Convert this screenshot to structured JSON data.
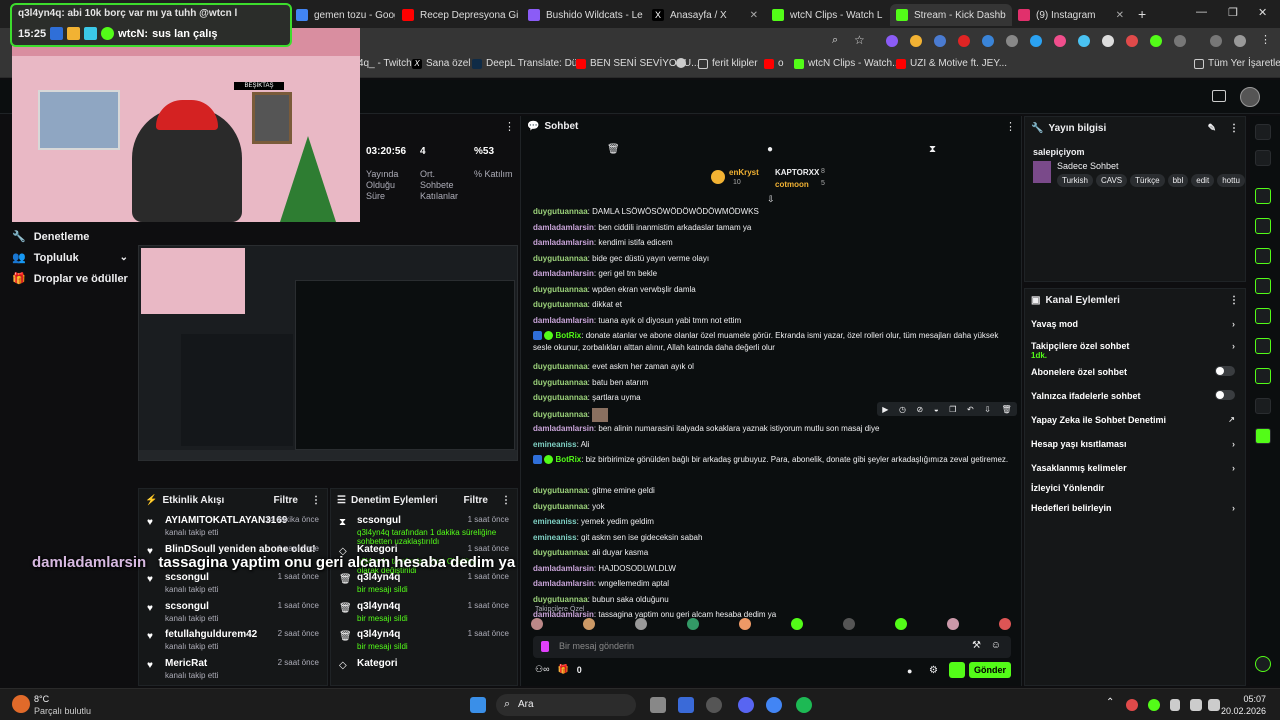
{
  "browser": {
    "tabs": [
      {
        "label": "gemen tozu - Google",
        "color": "#4285f4"
      },
      {
        "label": "Recep Depresyona Gi",
        "color": "#ff0000"
      },
      {
        "label": "Bushido Wildcats - Le",
        "color": "#8b5cf6"
      },
      {
        "label": "Anasayfa / X",
        "color": "#ffffff"
      },
      {
        "label": "wtcN Clips - Watch L",
        "color": "#53fc18"
      },
      {
        "label": "Stream - Kick Dashb",
        "color": "#53fc18"
      },
      {
        "label": "(9) Instagram",
        "color": "#e1306c"
      }
    ],
    "bookmarks": [
      "4q_ - Twitch",
      "Sana özel",
      "DeepL Translate: Dü...",
      "BEN SENİ SEVİYORU...",
      "o",
      "ferit klipler",
      "o",
      "wtcN Clips - Watch...",
      "UZI & Motive ft. JEY...",
      "Tüm Yer İşaretleri"
    ]
  },
  "overlay": {
    "chat_line1": "q3l4yn4q: abi 10k borç var mı ya tuhh @wtcn l",
    "chat_time": "15:25",
    "chat_line2_user": "wtcN:",
    "chat_line2_text": "sus lan çalış",
    "caption_user": "damladamlarsin",
    "caption_text": "tassagina yaptim onu geri alcam hesaba dedim ya"
  },
  "sidebar": {
    "items": [
      {
        "label": "Denetleme"
      },
      {
        "label": "Topluluk"
      },
      {
        "label": "Droplar ve ödüller"
      }
    ]
  },
  "stats": [
    {
      "value": "03:20:56",
      "label": "Yayında Olduğu Süre"
    },
    {
      "value": "4",
      "label": "Ort. Sohbete Katılanlar"
    },
    {
      "value": "%53",
      "label": "% Katılım"
    }
  ],
  "activity": {
    "title": "Etkinlik Akışı",
    "filter": "Filtre",
    "items": [
      {
        "name": "AYIAMITOKATLAYAN3169",
        "sub": "kanalı takip etti",
        "time": "14 dakika önce"
      },
      {
        "name": "BlinDSoull yeniden abone oldu!",
        "sub": "",
        "time": "1 saat önce"
      },
      {
        "name": "scsongul",
        "sub": "kanalı takip etti",
        "time": "1 saat önce"
      },
      {
        "name": "scsongul",
        "sub": "kanalı takip etti",
        "time": "1 saat önce"
      },
      {
        "name": "fetullahguldurem42",
        "sub": "kanalı takip etti",
        "time": "2 saat önce"
      },
      {
        "name": "MericRat",
        "sub": "kanalı takip etti",
        "time": "2 saat önce"
      }
    ]
  },
  "moderation": {
    "title": "Denetim Eylemleri",
    "filter": "Filtre",
    "items": [
      {
        "name": "scsongul",
        "sub": "q3l4yn4q tarafından 1 dakika süreliğine sohbetten uzaklaştırıldı",
        "time": "1 saat önce"
      },
      {
        "name": "Kategori",
        "sub": "q3l4yn4q tarafından Just Chatting olarak değiştirildi",
        "time": "1 saat önce"
      },
      {
        "name": "q3l4yn4q",
        "sub": "bir mesajı sildi",
        "time": "1 saat önce"
      },
      {
        "name": "q3l4yn4q",
        "sub": "bir mesajı sildi",
        "time": "1 saat önce"
      },
      {
        "name": "q3l4yn4q",
        "sub": "bir mesajı sildi",
        "time": "1 saat önce"
      },
      {
        "name": "Kategori",
        "sub": "",
        "time": ""
      }
    ]
  },
  "chat": {
    "title": "Sohbet",
    "top_users": [
      {
        "name": "enKryst",
        "badge": "10"
      },
      {
        "name": "KAPTORXX",
        "badge": "8"
      },
      {
        "name": "cotmoon",
        "badge": "5"
      }
    ],
    "messages": [
      {
        "user": "duygutuannaa",
        "cls": "u-d",
        "text": "DAMLA LSÖWÖSÖWÖDÖWÖDÖWMÖDWKS"
      },
      {
        "user": "damladamlarsin",
        "cls": "u-dm",
        "text": "ben ciddili inanmistim arkadaslar tamam ya"
      },
      {
        "user": "damladamlarsin",
        "cls": "u-dm",
        "text": "kendimi istifa edicem"
      },
      {
        "user": "duygutuannaa",
        "cls": "u-d",
        "text": "bide gec düstü yayın verme olayı"
      },
      {
        "user": "damladamlarsin",
        "cls": "u-dm",
        "text": "geri gel tm bekle"
      },
      {
        "user": "duygutuannaa",
        "cls": "u-d",
        "text": "wpden ekran verwbşlir damla"
      },
      {
        "user": "duygutuannaa",
        "cls": "u-d",
        "text": "dikkat et"
      },
      {
        "user": "damladamlarsin",
        "cls": "u-dm",
        "text": "tuana ayık ol diyosun yabi tmm not ettim"
      },
      {
        "user": "BotRix",
        "cls": "u-b",
        "text": "donate atanlar ve abone olanlar özel muamele görür. Ekranda ismi yazar, özel rolleri olur, tüm mesajları daha yüksek sesle okunur, zorbalıkları alttan alınır, Allah katında daha değerli olur"
      },
      {
        "user": "duygutuannaa",
        "cls": "u-d",
        "text": "evet askm her zaman ayık ol"
      },
      {
        "user": "duygutuannaa",
        "cls": "u-d",
        "text": "batu ben atarım"
      },
      {
        "user": "duygutuannaa",
        "cls": "u-d",
        "text": "şartlara uyma"
      },
      {
        "user": "duygutuannaa",
        "cls": "u-d",
        "text": ""
      },
      {
        "user": "damladamlarsin",
        "cls": "u-dm",
        "text": "ben alinin numarasini italyada sokaklara yaznak istiyorum mutlu son masaj diye"
      },
      {
        "user": "emineaniss",
        "cls": "u-e",
        "text": "Ali"
      },
      {
        "user": "BotRix",
        "cls": "u-b",
        "text": "biz birbirimize gönülden bağlı bir arkadaş grubuyuz. Para, abonelik, donate gibi şeyler arkadaşlığımıza zeval getiremez."
      },
      {
        "user": "duygutuannaa",
        "cls": "u-d",
        "text": "gitme emine geldi"
      },
      {
        "user": "duygutuannaa",
        "cls": "u-d",
        "text": "yok"
      },
      {
        "user": "emineaniss",
        "cls": "u-e",
        "text": "yemek yedim geldim"
      },
      {
        "user": "emineaniss",
        "cls": "u-e",
        "text": "git askm sen ise gideceksin sabah"
      },
      {
        "user": "duygutuannaa",
        "cls": "u-d",
        "text": "ali duyar kasma"
      },
      {
        "user": "damladamlarsin",
        "cls": "u-dm",
        "text": "HAJDOSODLWLDLW"
      },
      {
        "user": "damladamlarsin",
        "cls": "u-dm",
        "text": "wngellemedim aptal"
      },
      {
        "user": "duygutuannaa",
        "cls": "u-d",
        "text": "bubun saka olduğunu"
      },
      {
        "user": "damladamlarsin",
        "cls": "u-dm",
        "text": "tassagina yaptim onu geri alcam hesaba dedim ya"
      }
    ],
    "followers_only": "Takipçilere Özel",
    "input_placeholder": "Bir mesaj gönderin",
    "viewer_count": "0",
    "send_label": "Gönder"
  },
  "stream_info": {
    "title": "Yayın bilgisi",
    "stream_title": "salepiçiyom",
    "category": "Sadece Sohbet",
    "tags": [
      "Turkish",
      "CAVS",
      "Türkçe",
      "bbl",
      "edit",
      "hottu"
    ]
  },
  "channel_actions": {
    "title": "Kanal Eylemleri",
    "items": [
      {
        "label": "Yavaş mod",
        "kind": "arrow",
        "sub": ""
      },
      {
        "label": "Takipçilere özel sohbet",
        "kind": "arrow",
        "sub": "1dk."
      },
      {
        "label": "Abonelere özel sohbet",
        "kind": "toggle",
        "sub": ""
      },
      {
        "label": "Yalnızca ifadelerle sohbet",
        "kind": "toggle",
        "sub": ""
      },
      {
        "label": "Yapay Zeka ile Sohbet Denetimi",
        "kind": "ext",
        "sub": ""
      },
      {
        "label": "Hesap yaşı kısıtlaması",
        "kind": "arrow",
        "sub": ""
      },
      {
        "label": "Yasaklanmış kelimeler",
        "kind": "arrow",
        "sub": ""
      },
      {
        "label": "İzleyici Yönlendir",
        "kind": "none",
        "sub": ""
      },
      {
        "label": "Hedefleri belirleyin",
        "kind": "arrow",
        "sub": ""
      }
    ]
  },
  "taskbar": {
    "weather_temp": "8°C",
    "weather_desc": "Parçalı bulutlu",
    "search": "Ara",
    "time": "05:07",
    "date": "20.02.2026"
  },
  "colors": {
    "kick_green": "#53fc18",
    "bg": "#0e0e10"
  }
}
